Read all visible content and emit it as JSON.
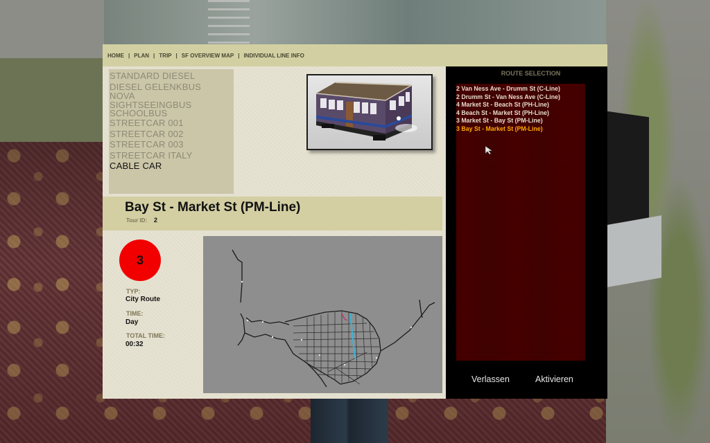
{
  "nav": {
    "items": [
      "HOME",
      "PLAN",
      "TRIP",
      "SF OVERVIEW MAP",
      "INDIVIDUAL LINE INFO"
    ],
    "separator": "|"
  },
  "vehicles": [
    "STANDARD DIESEL",
    "DIESEL GELENKBUS",
    "NOVA",
    "SIGHTSEEINGBUS",
    "SCHOOLBUS",
    "STREETCAR 001",
    "STREETCAR 002",
    "STREETCAR 003",
    "STREETCAR ITALY",
    "CABLE CAR"
  ],
  "selected_vehicle_index": 9,
  "route": {
    "title": "Bay St - Market St (PM-Line)",
    "tour_id_label": "Tour ID:",
    "tour_id": "2",
    "line_number": "3",
    "type_label": "TYP:",
    "type_value": "City Route",
    "time_label": "TIME:",
    "time_value": "Day",
    "total_time_label": "TOTAL TIME:",
    "total_time_value": "00:32"
  },
  "route_selection": {
    "header": "ROUTE SELECTION",
    "items": [
      "2 Van Ness Ave - Drumm St (C-Line)",
      "2 Drumm St - Van Ness Ave (C-Line)",
      "4 Market St - Beach St (PH-Line)",
      "4 Beach St - Market St (PH-Line)",
      "3 Market St - Bay St (PM-Line)",
      "3 Bay St - Market St (PM-Line)"
    ],
    "selected_index": 5
  },
  "buttons": {
    "leave": "Verlassen",
    "activate": "Aktivieren"
  },
  "colors": {
    "nav_bg": "#d2d0a2",
    "panel_bg": "#e7e3d2",
    "badge": "#f20000",
    "list_bg": "#4e0000",
    "selected_route": "#ffa800"
  },
  "icons": {
    "vehicle_preview": "cable-car-image",
    "pointer": "mouse-cursor-icon",
    "map": "route-network-map"
  }
}
